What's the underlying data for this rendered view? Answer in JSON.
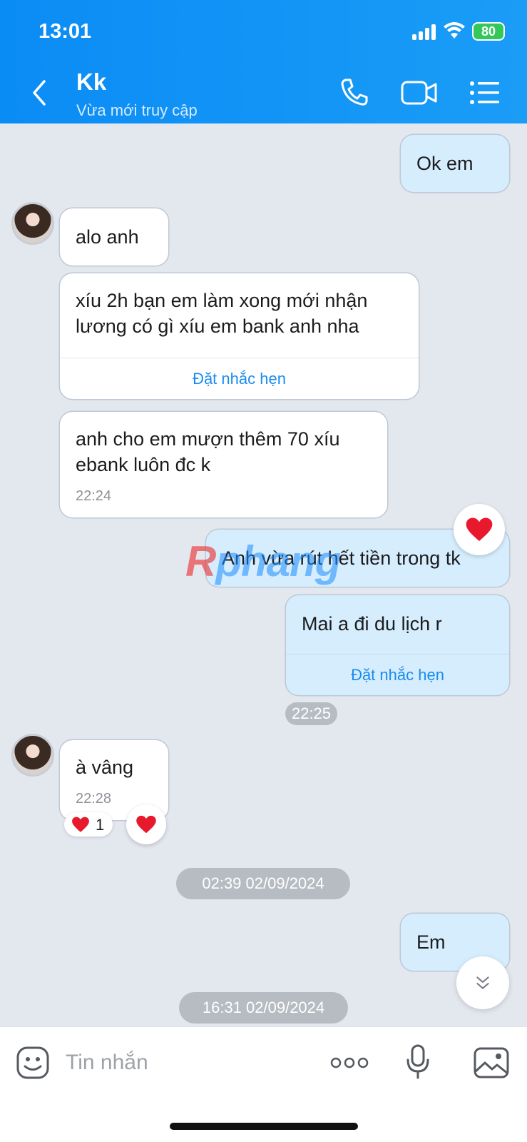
{
  "status_bar": {
    "time": "13:01",
    "battery": "80"
  },
  "header": {
    "contact_name": "Kk",
    "contact_status": "Vừa mới truy cập"
  },
  "messages": [
    {
      "dir": "out",
      "text": "Ok em"
    },
    {
      "dir": "in",
      "text": "alo anh"
    },
    {
      "dir": "in",
      "text": "xíu 2h bạn em làm xong mới nhận lương có gì xíu em bank anh nha",
      "remind": "Đặt nhắc hẹn"
    },
    {
      "dir": "in",
      "text": "anh cho em mượn thêm 70 xíu ebank luôn đc k",
      "time": "22:24"
    },
    {
      "dir": "out",
      "text": "Anh vừa rút hết tiền trong tk"
    },
    {
      "dir": "out",
      "text": "Mai a đi du lịch r",
      "remind": "Đặt nhắc hẹn"
    },
    {
      "dir": "in",
      "text": "à vâng",
      "time": "22:28",
      "reaction_count": "1"
    },
    {
      "dir": "out",
      "text": "Em"
    }
  ],
  "time_pills": [
    "22:25",
    "02:39 02/09/2024",
    "16:31 02/09/2024"
  ],
  "watermark": {
    "r": "R",
    "rest": "phang"
  },
  "input": {
    "placeholder": "Tin nhắn"
  },
  "colors": {
    "header": "#0a8cf5",
    "outgoing_bubble": "#d5edfd",
    "link": "#1a8cf0",
    "heart": "#e8192c"
  }
}
